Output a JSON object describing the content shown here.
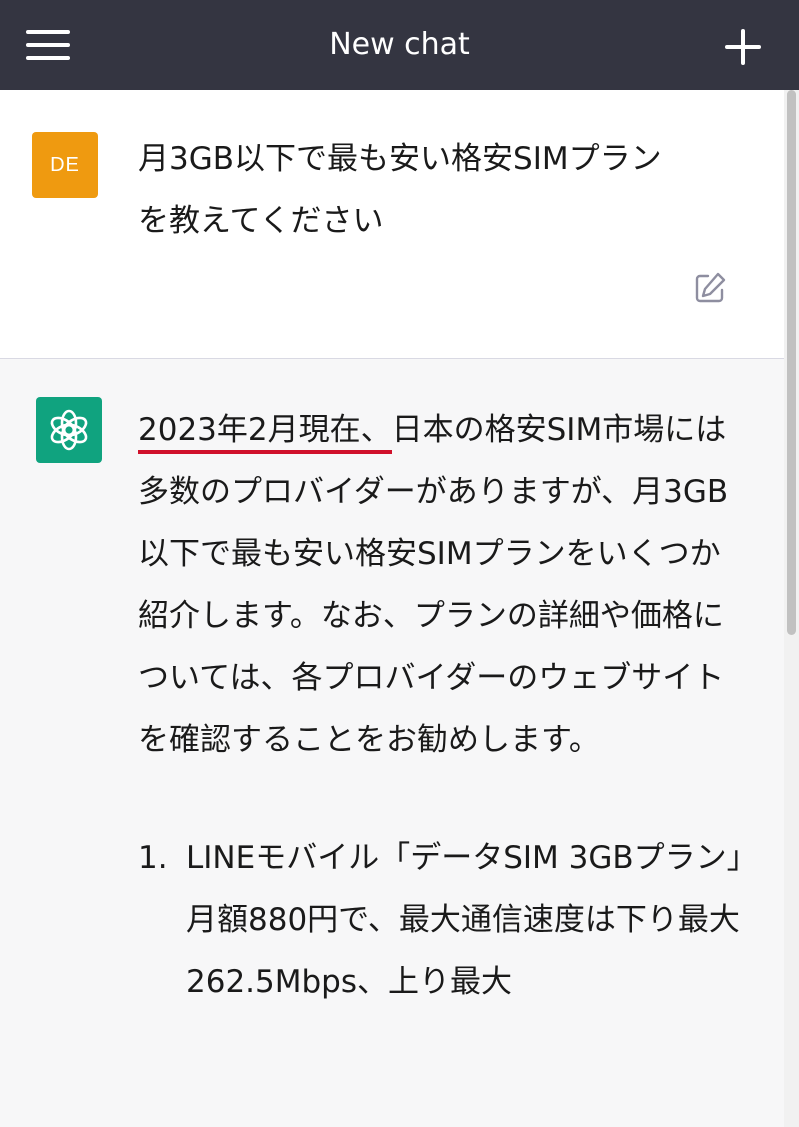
{
  "header": {
    "title": "New chat",
    "menu_icon": "hamburger-menu-icon",
    "new_chat_icon": "plus-icon"
  },
  "user_message": {
    "avatar_initials": "DE",
    "avatar_color": "#ef9a10",
    "text": "月3GB以下で最も安い格安SIMプラン\nを教えてください",
    "edit_icon": "edit-icon"
  },
  "assistant_message": {
    "avatar_color": "#10a37f",
    "avatar_icon": "openai-logo-icon",
    "intro_highlight": "2023年2月現在、",
    "intro_rest": "日本の格安SIM市場には多数のプロバイダーがありますが、月3GB以下で最も安い格安SIMプランをいくつか紹介します。なお、プランの詳細や価格については、各プロバイダーのウェブサイトを確認することをお勧めします。",
    "highlight_color": "#d0112b",
    "list": [
      {
        "number": "1.",
        "title": "LINEモバイル「データSIM 3GBプラン」",
        "description": "月額880円で、最大通信速度は下り最大262.5Mbps、上り最大"
      }
    ]
  }
}
